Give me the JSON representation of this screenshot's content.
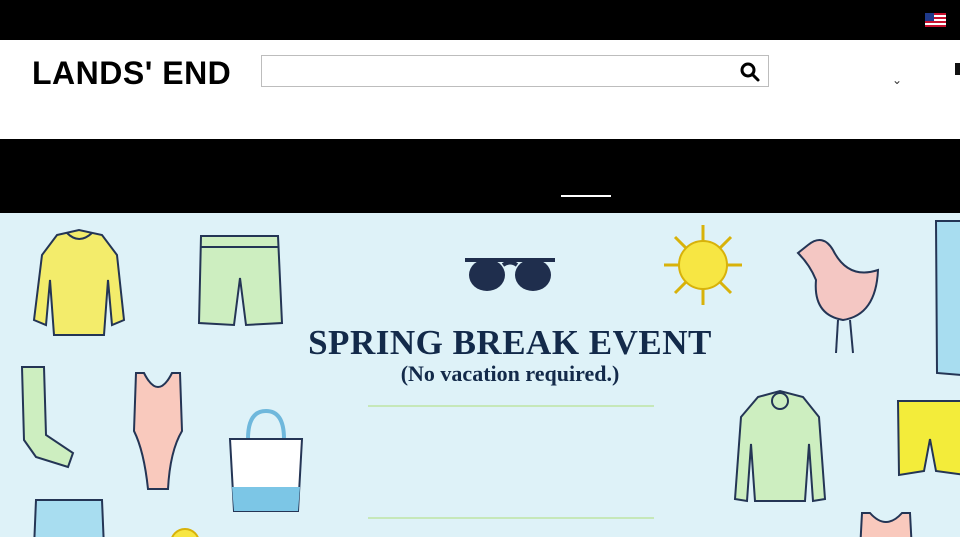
{
  "header": {
    "logo_text": "LANDS' END",
    "search": {
      "value": "",
      "placeholder": ""
    },
    "search_icon": "search-icon",
    "country_flag_icon": "us-flag-icon",
    "dropdown_icon": "chevron-down-icon",
    "dropdown_glyph": "⌄"
  },
  "hero": {
    "title": "SPRING BREAK EVENT",
    "subtitle": "(No vacation required.)"
  },
  "colors": {
    "topbar": "#000000",
    "hero_bg": "#def2f8",
    "title": "#132a4a",
    "rule": "#c6e8b9"
  }
}
